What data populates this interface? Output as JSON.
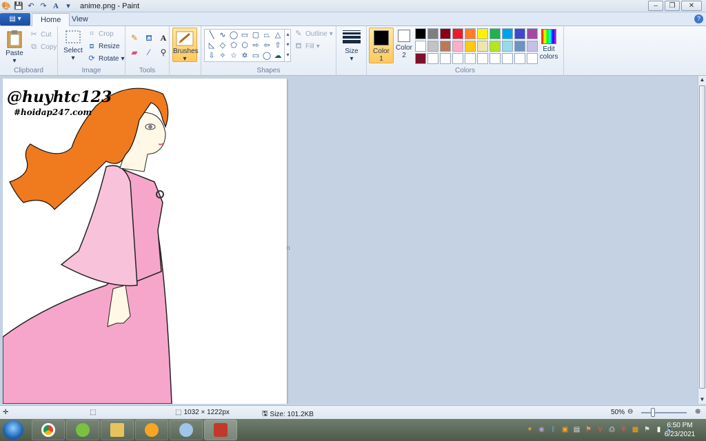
{
  "window": {
    "title": "anime.png - Paint"
  },
  "tabs": [
    {
      "label": "Home",
      "active": true
    },
    {
      "label": "View",
      "active": false
    }
  ],
  "ribbon": {
    "clipboard": {
      "label": "Clipboard",
      "paste": "Paste",
      "cut": "Cut",
      "copy": "Copy"
    },
    "image": {
      "label": "Image",
      "select": "Select",
      "crop": "Crop",
      "resize": "Resize",
      "rotate": "Rotate"
    },
    "tools": {
      "label": "Tools"
    },
    "brushes": {
      "label": "Brushes"
    },
    "shapes": {
      "label": "Shapes",
      "outline": "Outline",
      "fill": "Fill"
    },
    "size": {
      "label": "Size"
    },
    "colors": {
      "label": "Colors",
      "color1_label": "Color",
      "color1_num": "1",
      "color2_label": "Color",
      "color2_num": "2",
      "color1": "#000000",
      "color2": "#ffffff",
      "edit_line1": "Edit",
      "edit_line2": "colors",
      "palette": [
        "#000000",
        "#7f7f7f",
        "#880015",
        "#ed1c24",
        "#ff7f27",
        "#fff200",
        "#22b14c",
        "#00a2e8",
        "#3f48cc",
        "#a349a4",
        "#ffffff",
        "#c3c3c3",
        "#b97a57",
        "#ffaec9",
        "#ffc90e",
        "#efe4b0",
        "#b5e61d",
        "#99d9ea",
        "#7092be",
        "#c8bfe7",
        "#7f0f2a",
        "#ffffff",
        "#ffffff",
        "#ffffff",
        "#ffffff",
        "#ffffff",
        "#ffffff",
        "#ffffff",
        "#ffffff",
        "#ffffff"
      ]
    }
  },
  "canvas": {
    "watermark_handle": "@huyhtc123",
    "watermark_site": "#hoidap247.com",
    "colors": {
      "hair": "#f07a1e",
      "dress": "#f7a6cb",
      "dress_light": "#f9c2db",
      "skin": "#fff8e6"
    }
  },
  "status": {
    "dimensions": "1032 × 1222px",
    "size": "Size: 101.2KB",
    "zoom": "50%",
    "zoom_level": 0.5
  },
  "taskbar": {
    "time": "6:50 PM",
    "date": "6/23/2021"
  }
}
